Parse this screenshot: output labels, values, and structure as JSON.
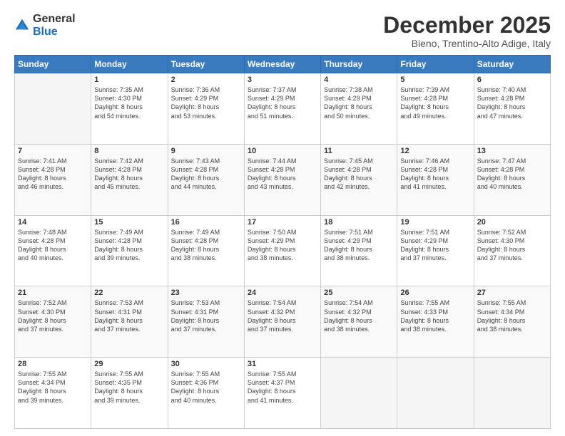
{
  "logo": {
    "general": "General",
    "blue": "Blue"
  },
  "header": {
    "title": "December 2025",
    "subtitle": "Bieno, Trentino-Alto Adige, Italy"
  },
  "weekdays": [
    "Sunday",
    "Monday",
    "Tuesday",
    "Wednesday",
    "Thursday",
    "Friday",
    "Saturday"
  ],
  "weeks": [
    [
      {
        "day": "",
        "info": ""
      },
      {
        "day": "1",
        "info": "Sunrise: 7:35 AM\nSunset: 4:30 PM\nDaylight: 8 hours\nand 54 minutes."
      },
      {
        "day": "2",
        "info": "Sunrise: 7:36 AM\nSunset: 4:29 PM\nDaylight: 8 hours\nand 53 minutes."
      },
      {
        "day": "3",
        "info": "Sunrise: 7:37 AM\nSunset: 4:29 PM\nDaylight: 8 hours\nand 51 minutes."
      },
      {
        "day": "4",
        "info": "Sunrise: 7:38 AM\nSunset: 4:29 PM\nDaylight: 8 hours\nand 50 minutes."
      },
      {
        "day": "5",
        "info": "Sunrise: 7:39 AM\nSunset: 4:28 PM\nDaylight: 8 hours\nand 49 minutes."
      },
      {
        "day": "6",
        "info": "Sunrise: 7:40 AM\nSunset: 4:28 PM\nDaylight: 8 hours\nand 47 minutes."
      }
    ],
    [
      {
        "day": "7",
        "info": "Sunrise: 7:41 AM\nSunset: 4:28 PM\nDaylight: 8 hours\nand 46 minutes."
      },
      {
        "day": "8",
        "info": "Sunrise: 7:42 AM\nSunset: 4:28 PM\nDaylight: 8 hours\nand 45 minutes."
      },
      {
        "day": "9",
        "info": "Sunrise: 7:43 AM\nSunset: 4:28 PM\nDaylight: 8 hours\nand 44 minutes."
      },
      {
        "day": "10",
        "info": "Sunrise: 7:44 AM\nSunset: 4:28 PM\nDaylight: 8 hours\nand 43 minutes."
      },
      {
        "day": "11",
        "info": "Sunrise: 7:45 AM\nSunset: 4:28 PM\nDaylight: 8 hours\nand 42 minutes."
      },
      {
        "day": "12",
        "info": "Sunrise: 7:46 AM\nSunset: 4:28 PM\nDaylight: 8 hours\nand 41 minutes."
      },
      {
        "day": "13",
        "info": "Sunrise: 7:47 AM\nSunset: 4:28 PM\nDaylight: 8 hours\nand 40 minutes."
      }
    ],
    [
      {
        "day": "14",
        "info": "Sunrise: 7:48 AM\nSunset: 4:28 PM\nDaylight: 8 hours\nand 40 minutes."
      },
      {
        "day": "15",
        "info": "Sunrise: 7:49 AM\nSunset: 4:28 PM\nDaylight: 8 hours\nand 39 minutes."
      },
      {
        "day": "16",
        "info": "Sunrise: 7:49 AM\nSunset: 4:28 PM\nDaylight: 8 hours\nand 38 minutes."
      },
      {
        "day": "17",
        "info": "Sunrise: 7:50 AM\nSunset: 4:29 PM\nDaylight: 8 hours\nand 38 minutes."
      },
      {
        "day": "18",
        "info": "Sunrise: 7:51 AM\nSunset: 4:29 PM\nDaylight: 8 hours\nand 38 minutes."
      },
      {
        "day": "19",
        "info": "Sunrise: 7:51 AM\nSunset: 4:29 PM\nDaylight: 8 hours\nand 37 minutes."
      },
      {
        "day": "20",
        "info": "Sunrise: 7:52 AM\nSunset: 4:30 PM\nDaylight: 8 hours\nand 37 minutes."
      }
    ],
    [
      {
        "day": "21",
        "info": "Sunrise: 7:52 AM\nSunset: 4:30 PM\nDaylight: 8 hours\nand 37 minutes."
      },
      {
        "day": "22",
        "info": "Sunrise: 7:53 AM\nSunset: 4:31 PM\nDaylight: 8 hours\nand 37 minutes."
      },
      {
        "day": "23",
        "info": "Sunrise: 7:53 AM\nSunset: 4:31 PM\nDaylight: 8 hours\nand 37 minutes."
      },
      {
        "day": "24",
        "info": "Sunrise: 7:54 AM\nSunset: 4:32 PM\nDaylight: 8 hours\nand 37 minutes."
      },
      {
        "day": "25",
        "info": "Sunrise: 7:54 AM\nSunset: 4:32 PM\nDaylight: 8 hours\nand 38 minutes."
      },
      {
        "day": "26",
        "info": "Sunrise: 7:55 AM\nSunset: 4:33 PM\nDaylight: 8 hours\nand 38 minutes."
      },
      {
        "day": "27",
        "info": "Sunrise: 7:55 AM\nSunset: 4:34 PM\nDaylight: 8 hours\nand 38 minutes."
      }
    ],
    [
      {
        "day": "28",
        "info": "Sunrise: 7:55 AM\nSunset: 4:34 PM\nDaylight: 8 hours\nand 39 minutes."
      },
      {
        "day": "29",
        "info": "Sunrise: 7:55 AM\nSunset: 4:35 PM\nDaylight: 8 hours\nand 39 minutes."
      },
      {
        "day": "30",
        "info": "Sunrise: 7:55 AM\nSunset: 4:36 PM\nDaylight: 8 hours\nand 40 minutes."
      },
      {
        "day": "31",
        "info": "Sunrise: 7:55 AM\nSunset: 4:37 PM\nDaylight: 8 hours\nand 41 minutes."
      },
      {
        "day": "",
        "info": ""
      },
      {
        "day": "",
        "info": ""
      },
      {
        "day": "",
        "info": ""
      }
    ]
  ]
}
